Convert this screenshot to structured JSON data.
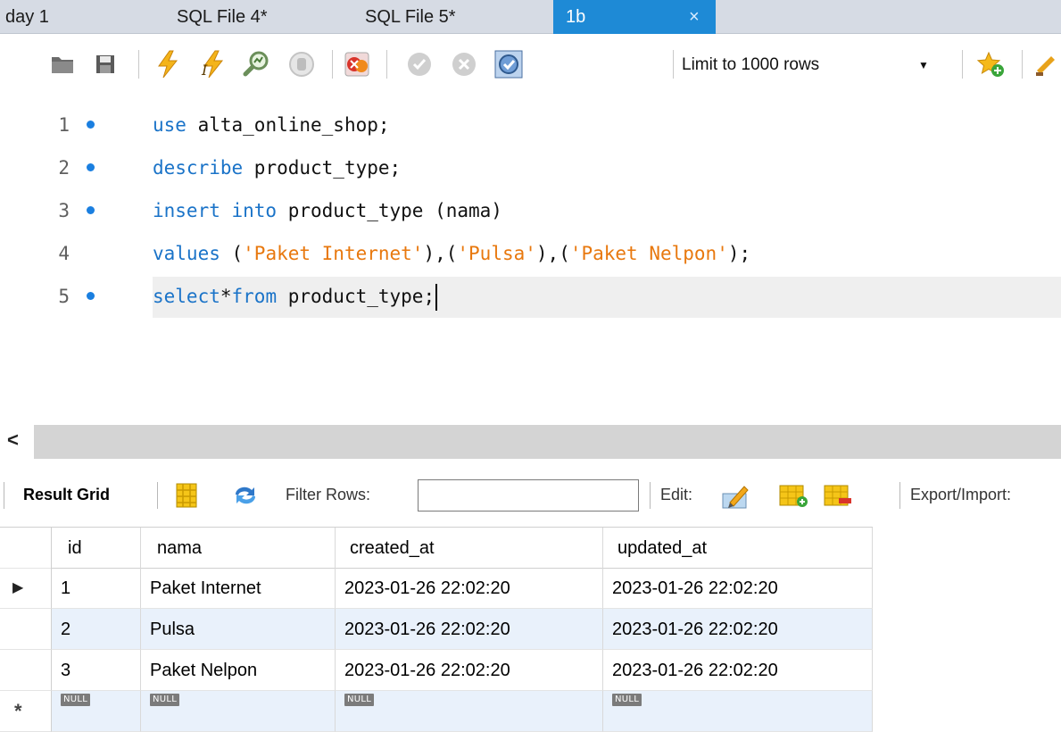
{
  "tabs": [
    {
      "label": "day 1",
      "active": false
    },
    {
      "label": "SQL File 4*",
      "active": false
    },
    {
      "label": "SQL File 5*",
      "active": false
    },
    {
      "label": "1b",
      "active": true,
      "close": "×"
    }
  ],
  "toolbar": {
    "icons": [
      "open-folder-icon",
      "save-icon",
      "execute-icon",
      "execute-current-icon",
      "explain-icon",
      "stop-icon",
      "toggle-error-icon",
      "commit-icon",
      "rollback-icon",
      "autocommit-icon",
      "add-snippet-icon",
      "beautify-icon"
    ],
    "limit_select": "Limit to 1000 rows"
  },
  "editor": {
    "lines": [
      {
        "number": "1",
        "has_dot": true
      },
      {
        "number": "2",
        "has_dot": true
      },
      {
        "number": "3",
        "has_dot": true
      },
      {
        "number": "4",
        "has_dot": false
      },
      {
        "number": "5",
        "has_dot": true
      }
    ],
    "code": {
      "l1_kw": "use",
      "l1_rest": " alta_online_shop;",
      "l2_kw": "describe",
      "l2_rest": " product_type;",
      "l3_kw": "insert into",
      "l3_rest": " product_type (nama)",
      "l4_kw": "values",
      "l4_p1": " (",
      "l4_s1": "'Paket Internet'",
      "l4_p2": "),(",
      "l4_s2": "'Pulsa'",
      "l4_p3": "),(",
      "l4_s3": "'Paket Nelpon'",
      "l4_p4": ");",
      "l5_kw1": "select",
      "l5_p1": "*",
      "l5_kw2": "from",
      "l5_rest": " product_type;"
    }
  },
  "scrollbar": {
    "left_arrow": "<"
  },
  "result_toolbar": {
    "result_grid": "Result Grid",
    "filter_rows": "Filter Rows:",
    "filter_value": "",
    "edit": "Edit:",
    "export_import": "Export/Import:"
  },
  "grid": {
    "columns": [
      "id",
      "nama",
      "created_at",
      "updated_at"
    ],
    "rows": [
      [
        "1",
        "Paket Internet",
        "2023-01-26 22:02:20",
        "2023-01-26 22:02:20"
      ],
      [
        "2",
        "Pulsa",
        "2023-01-26 22:02:20",
        "2023-01-26 22:02:20"
      ],
      [
        "3",
        "Paket Nelpon",
        "2023-01-26 22:02:20",
        "2023-01-26 22:02:20"
      ]
    ],
    "null_label": "NULL",
    "row_pointer": "▶",
    "new_row_marker": "*"
  },
  "colors": {
    "keyword": "#1a73c8",
    "string": "#e8780e",
    "active_tab": "#1e8ad6",
    "line_dot": "#1a7fe0",
    "alt_row": "#e9f1fb"
  }
}
